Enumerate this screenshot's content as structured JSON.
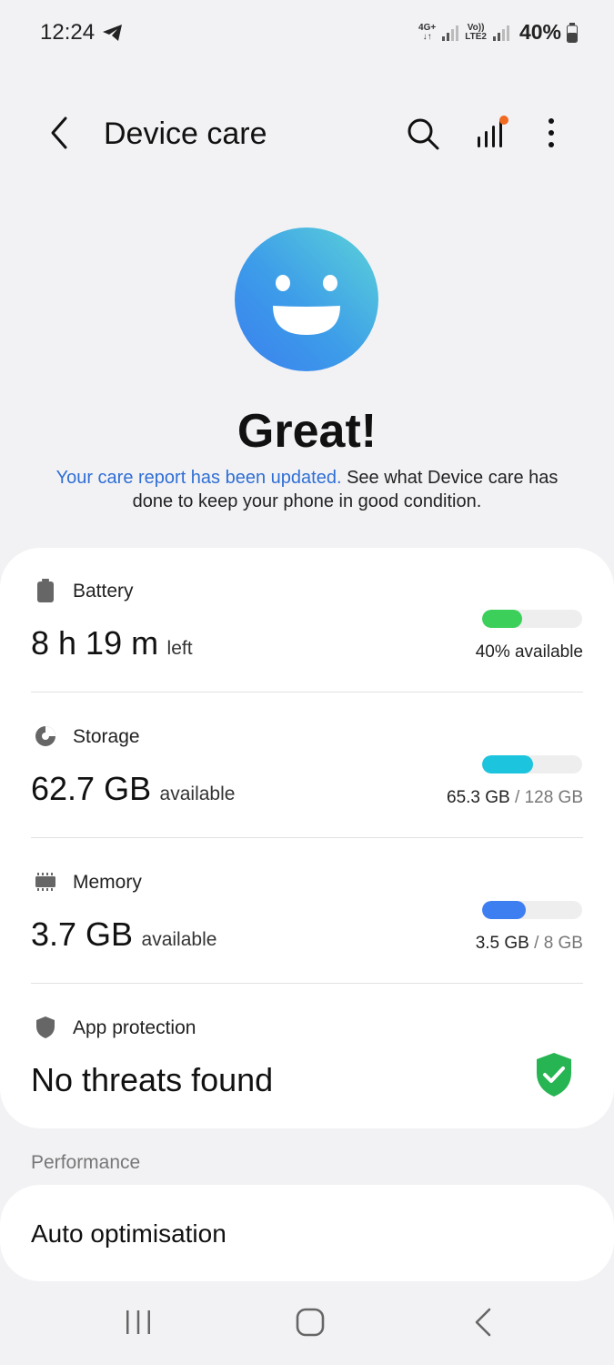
{
  "status_bar": {
    "time": "12:24",
    "network_1_top": "4G+",
    "network_1_bottom": "↓↑",
    "network_2_top": "Vo))",
    "network_2_bottom": "LTE2",
    "battery_percent": "40%"
  },
  "header": {
    "title": "Device care"
  },
  "hero": {
    "heading": "Great!",
    "desc_link": "Your care report has been updated.",
    "desc_rest": " See what Device care has done to keep your phone in good condition."
  },
  "battery": {
    "label": "Battery",
    "value": "8 h 19 m",
    "unit": "left",
    "level_fraction": 0.4,
    "bar_color": "#3ccf5a",
    "caption": "40% available"
  },
  "storage": {
    "label": "Storage",
    "value": "62.7 GB",
    "unit": "available",
    "level_fraction": 0.51,
    "bar_color": "#1cc4de",
    "used": "65.3 GB",
    "separator": " / ",
    "total": "128 GB"
  },
  "memory": {
    "label": "Memory",
    "value": "3.7 GB",
    "unit": "available",
    "level_fraction": 0.44,
    "bar_color": "#3d7ef0",
    "used": "3.5 GB",
    "separator": " / ",
    "total": "8 GB"
  },
  "app_protection": {
    "label": "App protection",
    "value": "No threats found"
  },
  "performance": {
    "section_label": "Performance",
    "item": "Auto optimisation"
  },
  "colors": {
    "accent_link": "#2f6fd4",
    "notification_dot": "#f06a22",
    "shield_green": "#26b552"
  },
  "icons": {
    "back": "chevron-left-icon",
    "search": "search-icon",
    "stats": "bar-chart-icon",
    "more": "more-vertical-icon",
    "battery": "battery-icon",
    "storage": "pie-chart-icon",
    "memory": "memory-chip-icon",
    "protection": "shield-icon",
    "protected": "shield-check-icon"
  }
}
